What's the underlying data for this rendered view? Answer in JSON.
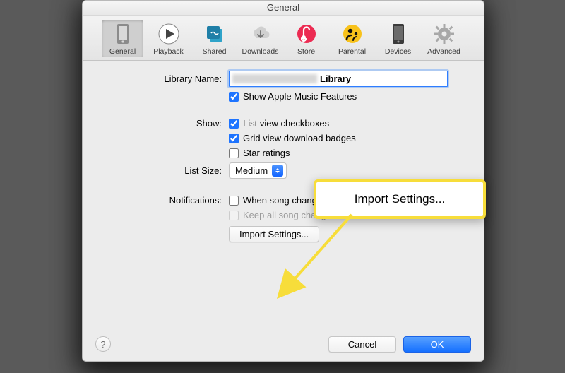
{
  "title": "General",
  "toolbar": [
    {
      "id": "general",
      "label": "General"
    },
    {
      "id": "playback",
      "label": "Playback"
    },
    {
      "id": "shared",
      "label": "Shared"
    },
    {
      "id": "downloads",
      "label": "Downloads"
    },
    {
      "id": "store",
      "label": "Store"
    },
    {
      "id": "parental",
      "label": "Parental"
    },
    {
      "id": "devices",
      "label": "Devices"
    },
    {
      "id": "advanced",
      "label": "Advanced"
    }
  ],
  "library_name_label": "Library Name:",
  "library_name_value": "Library",
  "show_apple_music": "Show Apple Music Features",
  "show_label": "Show:",
  "list_view_checkboxes": "List view checkboxes",
  "grid_view_badges": "Grid view download badges",
  "star_ratings": "Star ratings",
  "list_size_label": "List Size:",
  "list_size_value": "Medium",
  "notifications_label": "Notifications:",
  "when_song_changes": "When song changes",
  "keep_in_nc": "Keep all song changes in Notification Center",
  "import_settings": "Import Settings...",
  "cancel": "Cancel",
  "ok": "OK",
  "callout": "Import Settings..."
}
